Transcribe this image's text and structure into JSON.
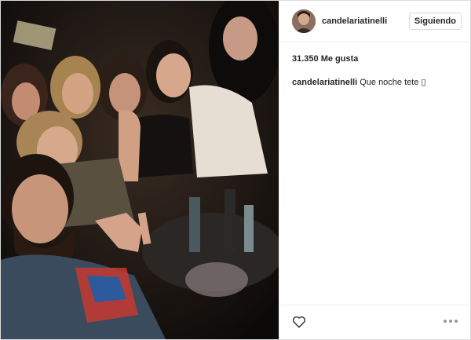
{
  "post": {
    "username": "candelariatinelli",
    "follow_label": "Siguiendo",
    "likes_text": "31.350 Me gusta",
    "caption": {
      "username": "candelariatinelli",
      "text": "Que noche tete ▯"
    }
  },
  "icons": {
    "like": "heart-outline-icon",
    "more": "more-options-icon"
  }
}
